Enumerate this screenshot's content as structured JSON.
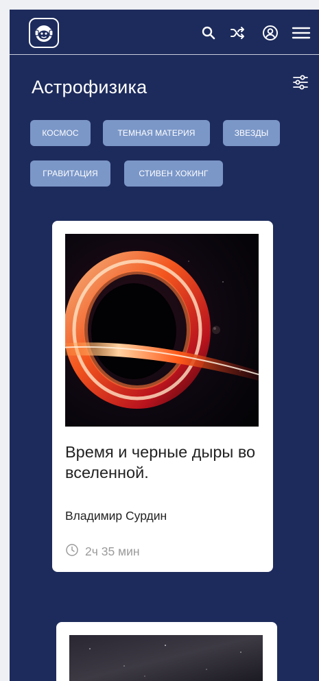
{
  "header": {
    "logo_icon": "monkey-logo-icon",
    "icons": [
      "search-icon",
      "shuffle-icon",
      "account-icon",
      "menu-icon"
    ]
  },
  "page": {
    "title": "Астрофизика",
    "filter_icon": "sliders-icon"
  },
  "tags": [
    {
      "label": "КОСМОС"
    },
    {
      "label": "ТЕМНАЯ МАТЕРИЯ"
    },
    {
      "label": "ЗВЕЗДЫ"
    },
    {
      "label": "ГРАВИТАЦИЯ"
    },
    {
      "label": "СТИВЕН ХОКИНГ"
    }
  ],
  "cards": [
    {
      "title": "Время и черные дыры во вселенной.",
      "author": "Владимир Сурдин",
      "duration": "2ч 35 мин",
      "image": "black-hole-image"
    },
    {
      "image": "starry-sky-image"
    }
  ],
  "colors": {
    "background": "#1d2b5c",
    "tag": "#7b97c8",
    "card": "#ffffff",
    "muted": "#9a9a9a"
  }
}
